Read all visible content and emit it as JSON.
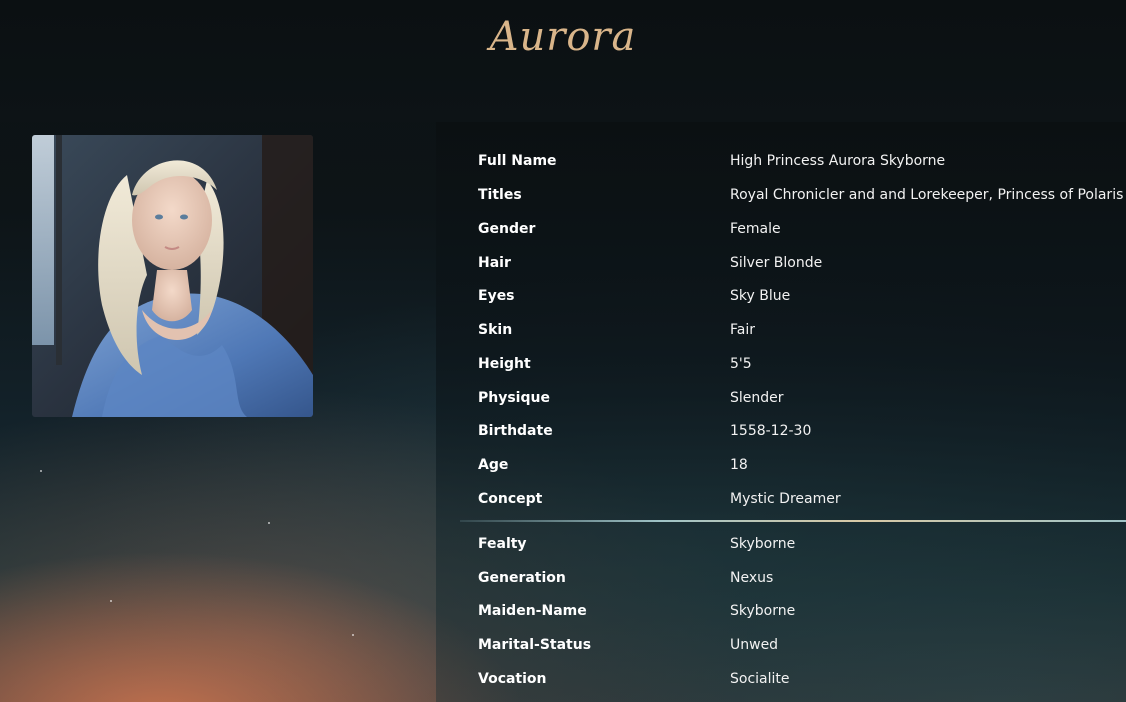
{
  "header": {
    "title": "Aurora"
  },
  "portrait": {
    "description_icon": "portrait-image"
  },
  "profile": {
    "primary": [
      {
        "label": "Full Name",
        "value": "High Princess Aurora Skyborne"
      },
      {
        "label": "Titles",
        "value": "Royal Chronicler and and Lorekeeper, Princess of Polaris"
      },
      {
        "label": "Gender",
        "value": "Female"
      },
      {
        "label": "Hair",
        "value": "Silver Blonde"
      },
      {
        "label": "Eyes",
        "value": "Sky Blue"
      },
      {
        "label": "Skin",
        "value": "Fair"
      },
      {
        "label": "Height",
        "value": "5'5"
      },
      {
        "label": "Physique",
        "value": "Slender"
      },
      {
        "label": "Birthdate",
        "value": "1558-12-30"
      },
      {
        "label": "Age",
        "value": "18"
      },
      {
        "label": "Concept",
        "value": "Mystic Dreamer"
      }
    ],
    "secondary": [
      {
        "label": "Fealty",
        "value": "Skyborne"
      },
      {
        "label": "Generation",
        "value": "Nexus"
      },
      {
        "label": "Maiden-Name",
        "value": "Skyborne"
      },
      {
        "label": "Marital-Status",
        "value": "Unwed"
      },
      {
        "label": "Vocation",
        "value": "Socialite"
      }
    ]
  },
  "colors": {
    "title": "#d9b58a",
    "background": "#0b1012",
    "divider": "#9fc3c6"
  }
}
